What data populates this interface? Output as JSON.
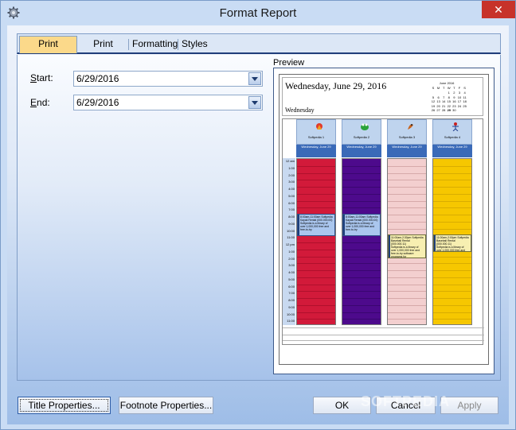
{
  "window": {
    "title": "Format Report",
    "close_glyph": "✕",
    "app_icon": "gear-icon"
  },
  "tabs": [
    {
      "label": "Print Ranges",
      "active": true
    },
    {
      "label": "Print Styles",
      "active": false
    },
    {
      "label": "Formatting",
      "active": false
    },
    {
      "label": "Styles",
      "active": false
    }
  ],
  "form": {
    "start_label_underline": "S",
    "start_label_rest": "tart:",
    "start_value": "6/29/2016",
    "end_label_underline": "E",
    "end_label_rest": "nd:",
    "end_value": "6/29/2016"
  },
  "preview": {
    "label": "Preview",
    "date_title": "Wednesday, June 29, 2016",
    "day_name": "Wednesday",
    "mini_calendar": {
      "title": "June 2016",
      "weekdays": [
        "S",
        "M",
        "T",
        "W",
        "T",
        "F",
        "S"
      ],
      "rows": [
        [
          "",
          "",
          "",
          "1",
          "2",
          "3",
          "4"
        ],
        [
          "5",
          "6",
          "7",
          "8",
          "9",
          "10",
          "11"
        ],
        [
          "12",
          "13",
          "14",
          "15",
          "16",
          "17",
          "18"
        ],
        [
          "19",
          "20",
          "21",
          "22",
          "23",
          "24",
          "25"
        ],
        [
          "26",
          "27",
          "28",
          "29",
          "30",
          "",
          ""
        ]
      ]
    },
    "resources": [
      {
        "name": "Softpedia 1",
        "sub": "Wednesday, June 29",
        "color": "#d21a3a",
        "line": "#b0102c",
        "icon": "bird-icon"
      },
      {
        "name": "Softpedia 2",
        "sub": "Wednesday, June 29",
        "color": "#4d0a8c",
        "line": "#3a0670",
        "icon": "frog-icon"
      },
      {
        "name": "Softpedia 3",
        "sub": "Wednesday, June 29",
        "color": "#f3cfcf",
        "line": "#d6a9a9",
        "icon": "parrot-icon"
      },
      {
        "name": "Softpedia 4",
        "sub": "Wednesday, June 29",
        "color": "#f6c700",
        "line": "#d9ad00",
        "icon": "stickman-icon"
      }
    ],
    "times": [
      "12 am",
      "1:00",
      "2:00",
      "3:00",
      "4:00",
      "5:00",
      "6:00",
      "7:00",
      "8:00",
      "9:00",
      "10:00",
      "11:00",
      "12 pm",
      "1:00",
      "2:00",
      "3:00",
      "4:00",
      "5:00",
      "6:00",
      "7:00",
      "8:00",
      "9:00",
      "10:00",
      "11:00"
    ],
    "appointments": [
      {
        "title": "8:00am-11:00am Softpedia Kayak Rental (000.000.00)",
        "body": "Softpedia is a library of over 1,000,000 free and free-to-try",
        "style": "blue"
      },
      {
        "title": "8:00am-11:00am Softpedia Kayak Rental (000.000.00)",
        "body": "Softpedia is a library of over 1,000,000 free and free-to-try",
        "style": "blue"
      },
      {
        "title": "11:00am-2:30pm Softpedia Baseball Rental (000.000.11)",
        "body": "Softpedia is a library of over 1,000,000 free and free-to-try software programs for",
        "style": "yellow"
      },
      {
        "title": "11:00am-2:00pm Softpedia Baseball Rental (000.000.11)",
        "body": "Softpedia is a library of over 1,000,000 free and free-to-try software programs for",
        "style": "yellow"
      }
    ]
  },
  "buttons": {
    "title_properties": "Title Properties...",
    "footnote_properties": "Footnote Properties...",
    "ok": "OK",
    "cancel": "Cancel",
    "apply": "Apply"
  },
  "watermark": "SOFTPEDIA"
}
